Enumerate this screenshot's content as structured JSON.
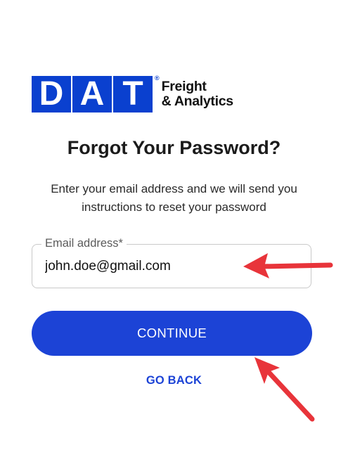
{
  "logo": {
    "letters": [
      "D",
      "A",
      "T"
    ],
    "registered": "®",
    "tagline_line1": "Freight",
    "tagline_line2": "& Analytics"
  },
  "heading": "Forgot Your Password?",
  "subtitle": "Enter your email address and we will send you instructions to reset your password",
  "email_field": {
    "label": "Email address*",
    "value": "john.doe@gmail.com"
  },
  "continue_label": "CONTINUE",
  "go_back_label": "GO BACK",
  "colors": {
    "brand_blue": "#1c43d6",
    "annotation_red": "#e8343a"
  }
}
